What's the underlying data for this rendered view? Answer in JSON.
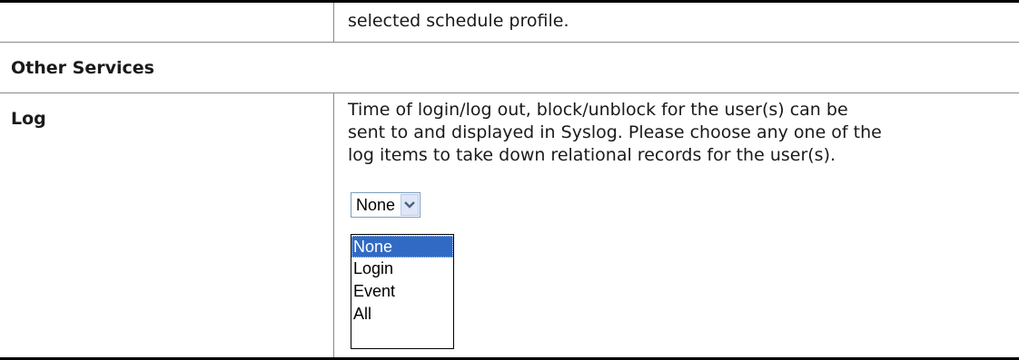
{
  "table": {
    "row_prev": {
      "description": "selected schedule profile."
    },
    "section_header": "Other Services",
    "log_row": {
      "label": "Log",
      "description_lines": [
        "Time of login/log out, block/unblock for the user(s) can be",
        "sent to and displayed in Syslog. Please choose any one of the",
        "log items to take down relational records for the user(s)."
      ],
      "select": {
        "value": "None",
        "icon": "chevron-down-icon",
        "options": [
          "None",
          "Login",
          "Event",
          "All"
        ],
        "highlighted_option": "None"
      }
    }
  },
  "colors": {
    "rule": "#000000",
    "grid": "#8a8a8a",
    "selected_bg": "#316ac5",
    "select_border": "#7f9db9",
    "arrow_bg": "#dfe7f7"
  }
}
